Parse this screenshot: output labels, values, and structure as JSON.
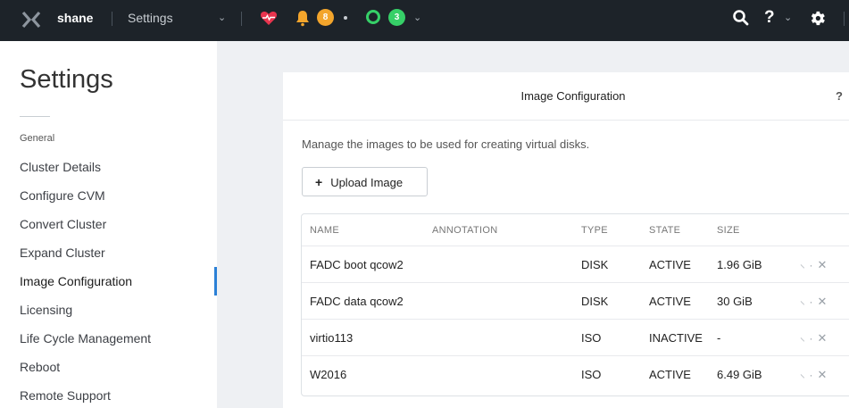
{
  "topbar": {
    "cluster_name": "shane",
    "breadcrumb": "Settings",
    "alerts_count": "8",
    "tasks_count": "3",
    "icons": {
      "logo": "nutanix-x-logo",
      "health": "heart-pulse-icon",
      "alerts": "bell-icon",
      "tasks": "ring-icon",
      "search": "search-icon",
      "help": "question-icon",
      "settings": "gear-icon"
    },
    "colors": {
      "alerts_badge": "#f3a52c",
      "tasks_badge": "#36d068",
      "health": "#e8344e"
    }
  },
  "sidebar": {
    "title": "Settings",
    "section": "General",
    "items": [
      {
        "label": "Cluster Details"
      },
      {
        "label": "Configure CVM"
      },
      {
        "label": "Convert Cluster"
      },
      {
        "label": "Expand Cluster"
      },
      {
        "label": "Image Configuration",
        "active": true
      },
      {
        "label": "Licensing"
      },
      {
        "label": "Life Cycle Management"
      },
      {
        "label": "Reboot"
      },
      {
        "label": "Remote Support"
      }
    ]
  },
  "panel": {
    "title": "Image Configuration",
    "help": "?",
    "description": "Manage the images to be used for creating virtual disks.",
    "upload_label": "Upload Image",
    "columns": {
      "name": "NAME",
      "annotation": "ANNOTATION",
      "type": "TYPE",
      "state": "STATE",
      "size": "SIZE"
    },
    "rows": [
      {
        "name": "FADC boot qcow2",
        "annotation": "",
        "type": "DISK",
        "state": "ACTIVE",
        "size": "1.96 GiB"
      },
      {
        "name": "FADC data qcow2",
        "annotation": "",
        "type": "DISK",
        "state": "ACTIVE",
        "size": "30 GiB"
      },
      {
        "name": "virtio113",
        "annotation": "",
        "type": "ISO",
        "state": "INACTIVE",
        "size": "-"
      },
      {
        "name": "W2016",
        "annotation": "",
        "type": "ISO",
        "state": "ACTIVE",
        "size": "6.49 GiB"
      }
    ]
  }
}
